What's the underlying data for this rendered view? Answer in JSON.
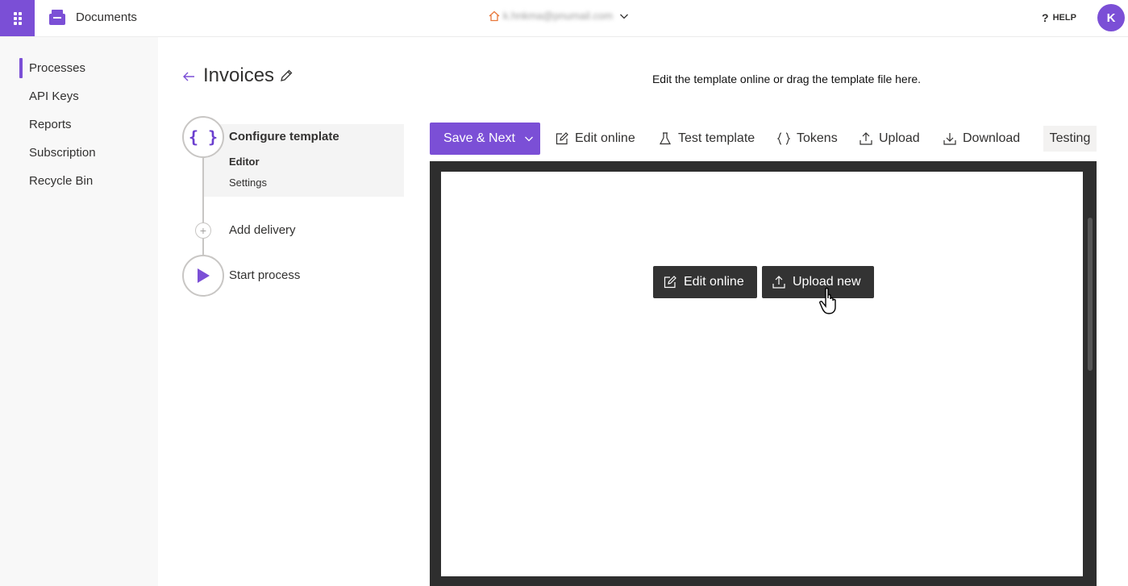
{
  "topbar": {
    "app_title": "Documents",
    "account_email": "k.hnkma@pnumail.com",
    "help_label": "HELP",
    "avatar_initial": "K"
  },
  "sidebar": {
    "items": [
      {
        "label": "Processes",
        "active": true
      },
      {
        "label": "API Keys"
      },
      {
        "label": "Reports"
      },
      {
        "label": "Subscription"
      },
      {
        "label": "Recycle Bin"
      }
    ]
  },
  "page": {
    "title": "Invoices"
  },
  "stepper": {
    "step1": {
      "label": "Configure template",
      "icon": "braces-icon",
      "braces": "{ }"
    },
    "sub_steps": [
      {
        "label": "Editor",
        "active": true
      },
      {
        "label": "Settings"
      }
    ],
    "add_delivery": "Add delivery",
    "plus": "+",
    "start_process": "Start process"
  },
  "toolbar": {
    "save_next": "Save & Next",
    "edit_online": "Edit online",
    "test_template": "Test template",
    "tokens": "Tokens",
    "upload": "Upload",
    "download": "Download",
    "testing": "Testing"
  },
  "editor": {
    "hint": "Edit the template online or drag the template file here.",
    "edit_online": "Edit online",
    "upload_new": "Upload new"
  },
  "colors": {
    "accent": "#7b4fd6",
    "dark_button": "#333333",
    "frame": "#2e2e2e"
  }
}
